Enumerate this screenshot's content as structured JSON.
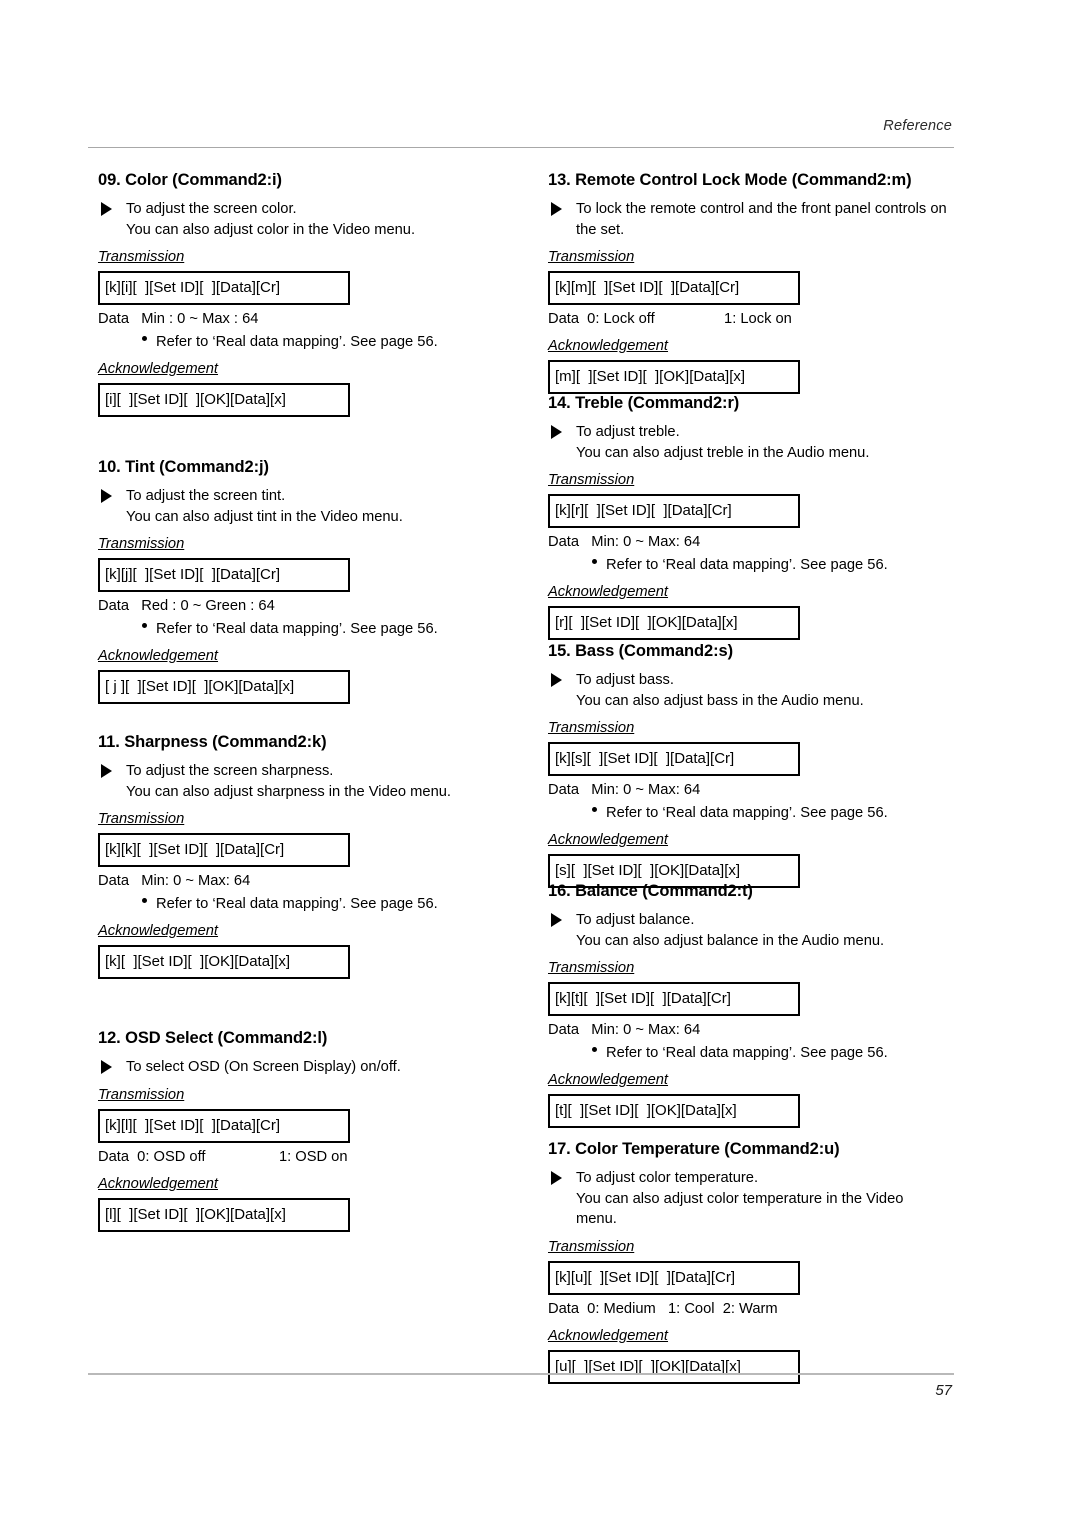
{
  "header": {
    "running_head": "Reference"
  },
  "footer": {
    "page_number": "57"
  },
  "labels": {
    "transmission": "Transmission",
    "acknowledgement": "Acknowledgement",
    "refnote": "Refer to ‘Real data mapping’. See page 56."
  },
  "left_column": [
    {
      "title": "09. Color (Command2:i)",
      "desc_line1": "To adjust the screen color.",
      "desc_line2": "You can also adjust color in the Video menu.",
      "transmission": "[k][i][  ][Set ID][  ][Data][Cr]",
      "data": "Data   Min : 0 ~ Max : 64",
      "has_refnote": true,
      "acknowledgement": "[i][  ][Set ID][  ][OK][Data][x]"
    },
    {
      "title": "10. Tint (Command2:j)",
      "desc_line1": "To adjust the screen tint.",
      "desc_line2": "You can also adjust tint in the Video menu.",
      "transmission": "[k][j][  ][Set ID][  ][Data][Cr]",
      "data": "Data   Red : 0 ~ Green : 64",
      "has_refnote": true,
      "acknowledgement": "[ j ][  ][Set ID][  ][OK][Data][x]"
    },
    {
      "title": "11. Sharpness (Command2:k)",
      "desc_line1": "To adjust the screen sharpness.",
      "desc_line2": "You can also adjust sharpness in the Video menu.",
      "transmission": "[k][k][  ][Set ID][  ][Data][Cr]",
      "data": "Data   Min: 0 ~ Max: 64",
      "has_refnote": true,
      "acknowledgement": "[k][  ][Set ID][  ][OK][Data][x]"
    },
    {
      "title": "12. OSD Select (Command2:l)",
      "desc_line1": "To select OSD (On Screen Display) on/off.",
      "desc_line2": "",
      "transmission": "[k][l][  ][Set ID][  ][Data][Cr]",
      "data": "Data  0: OSD off                  1: OSD on",
      "has_refnote": false,
      "acknowledgement": "[l][  ][Set ID][  ][OK][Data][x]"
    }
  ],
  "right_column": [
    {
      "title": "13. Remote Control Lock Mode (Command2:m)",
      "desc_line1": "To lock the remote control and the front panel controls on",
      "desc_line2": "the set.",
      "transmission": "[k][m][  ][Set ID][  ][Data][Cr]",
      "data": "Data  0: Lock off                 1: Lock on",
      "has_refnote": false,
      "acknowledgement": "[m][  ][Set ID][  ][OK][Data][x]"
    },
    {
      "title": "14. Treble (Command2:r)",
      "desc_line1": "To adjust treble.",
      "desc_line2": "You can also adjust treble in the Audio menu.",
      "transmission": "[k][r][  ][Set ID][  ][Data][Cr]",
      "data": "Data   Min: 0 ~ Max: 64",
      "has_refnote": true,
      "acknowledgement": "[r][  ][Set ID][  ][OK][Data][x]"
    },
    {
      "title": "15. Bass (Command2:s)",
      "desc_line1": "To adjust bass.",
      "desc_line2": "You can also adjust bass in the Audio menu.",
      "transmission": "[k][s][  ][Set ID][  ][Data][Cr]",
      "data": "Data   Min: 0 ~ Max: 64",
      "has_refnote": true,
      "acknowledgement": "[s][  ][Set ID][  ][OK][Data][x]"
    },
    {
      "title": "16. Balance (Command2:t)",
      "desc_line1": "To adjust balance.",
      "desc_line2": "You can also adjust balance in the Audio menu.",
      "transmission": "[k][t][  ][Set ID][  ][Data][Cr]",
      "data": "Data   Min: 0 ~ Max: 64",
      "has_refnote": true,
      "acknowledgement": "[t][  ][Set ID][  ][OK][Data][x]"
    },
    {
      "title": "17. Color Temperature (Command2:u)",
      "desc_line1": "To adjust color temperature.",
      "desc_line2": "You can also adjust color temperature in the Video",
      "desc_line3": "menu.",
      "transmission": "[k][u][  ][Set ID][  ][Data][Cr]",
      "data": "Data  0: Medium   1: Cool  2: Warm",
      "has_refnote": false,
      "acknowledgement": "[u][  ][Set ID][  ][OK][Data][x]"
    }
  ]
}
